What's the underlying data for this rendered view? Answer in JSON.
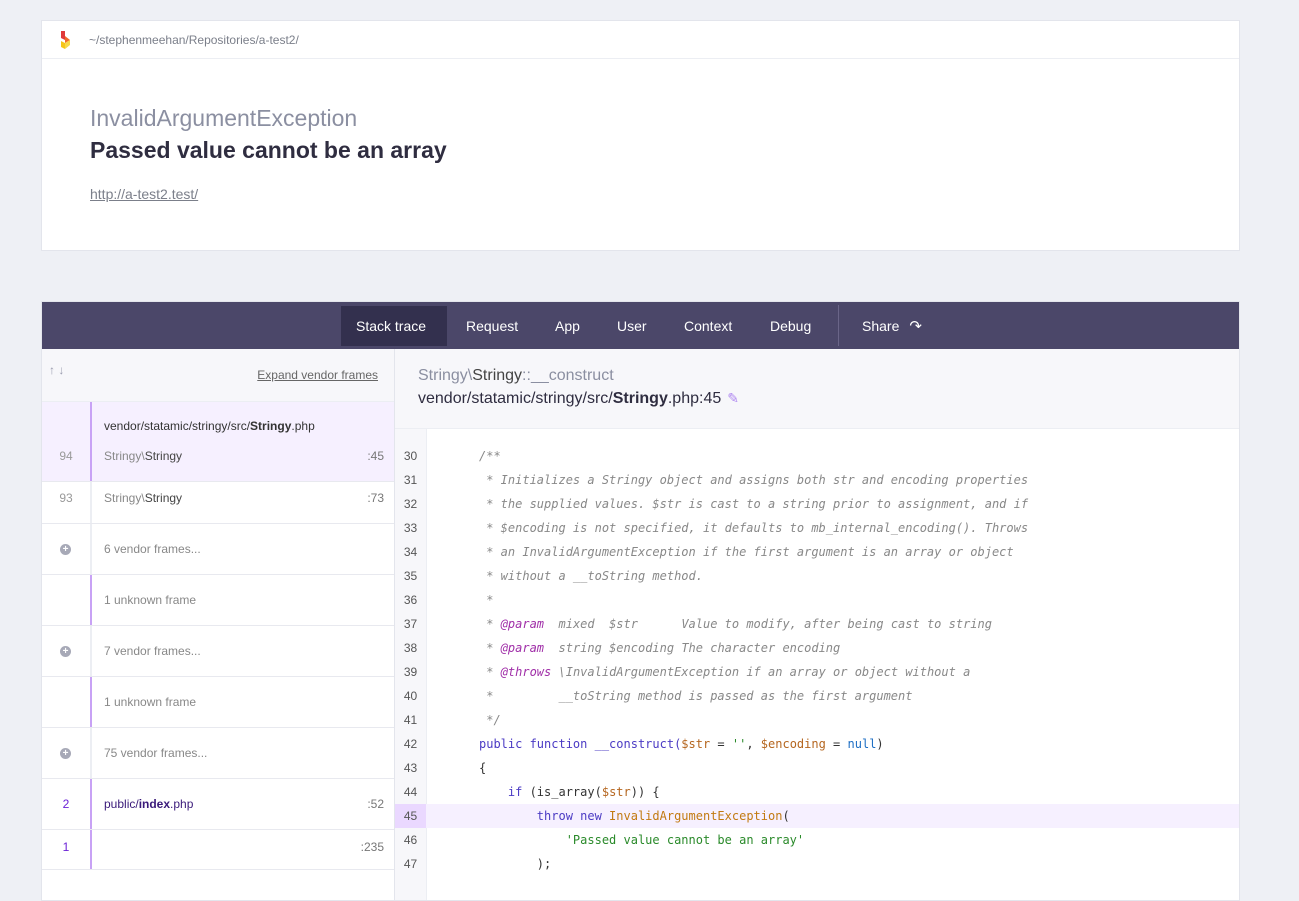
{
  "header": {
    "path": "~/stephenmeehan/Repositories/a-test2/",
    "exception_class": "InvalidArgumentException",
    "message": "Passed value cannot be an array",
    "url": "http://a-test2.test/"
  },
  "tabs": {
    "stack_trace": "Stack trace",
    "request": "Request",
    "app": "App",
    "user": "User",
    "context": "Context",
    "debug": "Debug",
    "share": "Share"
  },
  "sidebar": {
    "arrows": "↑ ↓",
    "expand": "Expand vendor frames",
    "frame94": {
      "number": "94",
      "file_prefix": "vendor/statamic/stringy/src/",
      "file_bold": "Stringy",
      "file_ext": ".php",
      "class_ns": "Stringy\\",
      "class_name": "Stringy",
      "line": ":45"
    },
    "frame93": {
      "number": "93",
      "class_ns": "Stringy\\",
      "class_name": "Stringy",
      "line": ":73"
    },
    "vendor6": "6 vendor frames...",
    "unknown1": "1 unknown frame",
    "vendor7": "7 vendor frames...",
    "unknown2": "1 unknown frame",
    "vendor75": "75 vendor frames...",
    "frame2": {
      "number": "2",
      "file_prefix": "public/",
      "file_bold": "index",
      "file_ext": ".php",
      "line": ":52"
    },
    "frame1": {
      "number": "1",
      "line": ":235"
    }
  },
  "detail": {
    "func_ns": "Stringy\\",
    "func_class": "Stringy",
    "func_method": "::__construct",
    "file_prefix": "vendor/statamic/stringy/src/",
    "file_bold": "Stringy",
    "file_suffix": ".php:45"
  },
  "code": {
    "l30": {
      "n": "30",
      "t": "/**"
    },
    "l31": {
      "n": "31",
      "t": " * Initializes a Stringy object and assigns both str and encoding properties"
    },
    "l32": {
      "n": "32",
      "t": " * the supplied values. $str is cast to a string prior to assignment, and if"
    },
    "l33": {
      "n": "33",
      "t": " * $encoding is not specified, it defaults to mb_internal_encoding(). Throws"
    },
    "l34": {
      "n": "34",
      "t": " * an InvalidArgumentException if the first argument is an array or object"
    },
    "l35": {
      "n": "35",
      "t": " * without a __toString method."
    },
    "l36": {
      "n": "36",
      "t": " *"
    },
    "l37": {
      "n": "37",
      "star": " * ",
      "tag": "@param",
      "rest": "  mixed  $str      Value to modify, after being cast to string"
    },
    "l38": {
      "n": "38",
      "star": " * ",
      "tag": "@param",
      "rest": "  string $encoding The character encoding"
    },
    "l39": {
      "n": "39",
      "star": " * ",
      "tag": "@throws",
      "rest": " \\InvalidArgumentException if an array or object without a"
    },
    "l40": {
      "n": "40",
      "t": " *         __toString method is passed as the first argument"
    },
    "l41": {
      "n": "41",
      "t": " */"
    },
    "l42": {
      "n": "42",
      "kw": "public function",
      "fn": " __construct(",
      "v1": "$str",
      "p1": " = ",
      "s1": "''",
      "p2": ", ",
      "v2": "$encoding",
      "p3": " = ",
      "nul": "null",
      "p4": ")"
    },
    "l43": {
      "n": "43",
      "t": "{"
    },
    "l44": {
      "n": "44",
      "pre": "    ",
      "kw": "if",
      "p1": " (is_array(",
      "v1": "$str",
      "p2": ")) {"
    },
    "l45": {
      "n": "45",
      "pre": "        ",
      "kw": "throw new",
      "cls": " InvalidArgumentException",
      "p1": "("
    },
    "l46": {
      "n": "46",
      "pre": "            ",
      "s": "'Passed value cannot be an array'"
    },
    "l47": {
      "n": "47",
      "t": "        );"
    }
  }
}
